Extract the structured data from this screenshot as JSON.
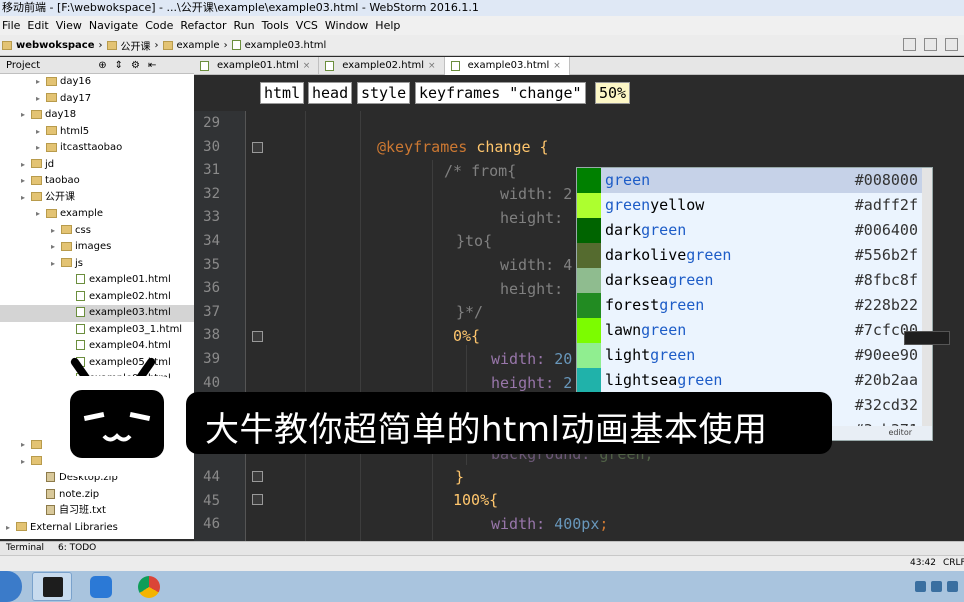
{
  "window": {
    "title": "移动前端 - [F:\\webwokspace] - ...\\公开课\\example\\example03.html - WebStorm 2016.1.1"
  },
  "menu": [
    "File",
    "Edit",
    "View",
    "Navigate",
    "Code",
    "Refactor",
    "Run",
    "Tools",
    "VCS",
    "Window",
    "Help"
  ],
  "nav": {
    "project": "webwokspace",
    "folder1": "公开课",
    "folder2": "example",
    "file": "example03.html"
  },
  "panel": {
    "label": "Project"
  },
  "tabs": [
    {
      "label": "example01.html"
    },
    {
      "label": "example02.html"
    },
    {
      "label": "example03.html"
    }
  ],
  "tree": [
    {
      "label": "day16",
      "type": "folder",
      "indent": 2
    },
    {
      "label": "day17",
      "type": "folder",
      "indent": 2
    },
    {
      "label": "day18",
      "type": "folder",
      "indent": 1
    },
    {
      "label": "html5",
      "type": "folder",
      "indent": 2
    },
    {
      "label": "itcasttaobao",
      "type": "folder",
      "indent": 2
    },
    {
      "label": "jd",
      "type": "folder",
      "indent": 1
    },
    {
      "label": "taobao",
      "type": "folder",
      "indent": 1
    },
    {
      "label": "公开课",
      "type": "folder",
      "indent": 1
    },
    {
      "label": "example",
      "type": "folder",
      "indent": 2
    },
    {
      "label": "css",
      "type": "folder",
      "indent": 3
    },
    {
      "label": "images",
      "type": "folder",
      "indent": 3
    },
    {
      "label": "js",
      "type": "folder",
      "indent": 3
    },
    {
      "label": "example01.html",
      "type": "html",
      "indent": 4
    },
    {
      "label": "example02.html",
      "type": "html",
      "indent": 4
    },
    {
      "label": "example03.html",
      "type": "html",
      "indent": 4,
      "selected": true
    },
    {
      "label": "example03_1.html",
      "type": "html",
      "indent": 4
    },
    {
      "label": "example04.html",
      "type": "html",
      "indent": 4
    },
    {
      "label": "example05.html",
      "type": "html",
      "indent": 4
    },
    {
      "label": "example06.html",
      "type": "html",
      "indent": 4
    },
    {
      "label": "",
      "type": "html",
      "indent": 4
    },
    {
      "label": "",
      "type": "html",
      "indent": 4
    },
    {
      "label": "",
      "type": "html",
      "indent": 4
    },
    {
      "label": "",
      "type": "folder",
      "indent": 1
    },
    {
      "label": "",
      "type": "folder",
      "indent": 1
    },
    {
      "label": "Desktop.zip",
      "type": "zip",
      "indent": 2
    },
    {
      "label": "note.zip",
      "type": "zip",
      "indent": 2
    },
    {
      "label": "自习班.txt",
      "type": "zip",
      "indent": 2
    },
    {
      "label": "External Libraries",
      "type": "folder",
      "indent": 0
    }
  ],
  "breadcrumbs": [
    "html",
    "head",
    "style",
    "keyframes \"change\"",
    "50%"
  ],
  "lines": [
    "29",
    "30",
    "31",
    "32",
    "33",
    "34",
    "35",
    "36",
    "37",
    "38",
    "39",
    "40",
    "",
    "",
    "",
    "44",
    "45",
    "46"
  ],
  "code": {
    "l30_kw": "@keyframes",
    "l30_name": " change {",
    "l31": "/* from{",
    "l32": "width: 2",
    "l33": "height:",
    "l34": "}to{",
    "l35": "width: 4",
    "l36": "height:",
    "l37": "}*/",
    "l38": "0%{",
    "l39_p": "width: ",
    "l39_v": "20",
    "l40_p": "height: ",
    "l40_v": "2",
    "l43_p": "background: ",
    "l43_v": "green;",
    "l44": "}",
    "l45": "100%{",
    "l46_p": "width: ",
    "l46_v": "400px",
    "l46_end": ";"
  },
  "autocomplete": [
    {
      "pre": "",
      "match": "green",
      "post": "",
      "hex": "#008000",
      "color": "#008000",
      "selected": true
    },
    {
      "pre": "",
      "match": "green",
      "post": "yellow",
      "hex": "#adff2f",
      "color": "#adff2f"
    },
    {
      "pre": "dark",
      "match": "green",
      "post": "",
      "hex": "#006400",
      "color": "#006400"
    },
    {
      "pre": "darkolive",
      "match": "green",
      "post": "",
      "hex": "#556b2f",
      "color": "#556b2f"
    },
    {
      "pre": "darksea",
      "match": "green",
      "post": "",
      "hex": "#8fbc8f",
      "color": "#8fbc8f"
    },
    {
      "pre": "forest",
      "match": "green",
      "post": "",
      "hex": "#228b22",
      "color": "#228b22"
    },
    {
      "pre": "lawn",
      "match": "green",
      "post": "",
      "hex": "#7cfc00",
      "color": "#7cfc00"
    },
    {
      "pre": "light",
      "match": "green",
      "post": "",
      "hex": "#90ee90",
      "color": "#90ee90"
    },
    {
      "pre": "lightsea",
      "match": "green",
      "post": "",
      "hex": "#20b2aa",
      "color": "#20b2aa"
    },
    {
      "pre": "",
      "match": "",
      "post": "",
      "hex": "#32cd32",
      "color": "#32cd32"
    },
    {
      "pre": "",
      "match": "",
      "post": "",
      "hex": "#3cb371",
      "color": "#3cb371"
    }
  ],
  "autocomplete_foot": "editor",
  "subtitle": "大牛教你超简单的html动画基本使用",
  "bottom_tools": {
    "terminal": "Terminal",
    "todo": "6: TODO"
  },
  "status": {
    "position": "43:42",
    "line_sep": "CRLF"
  }
}
